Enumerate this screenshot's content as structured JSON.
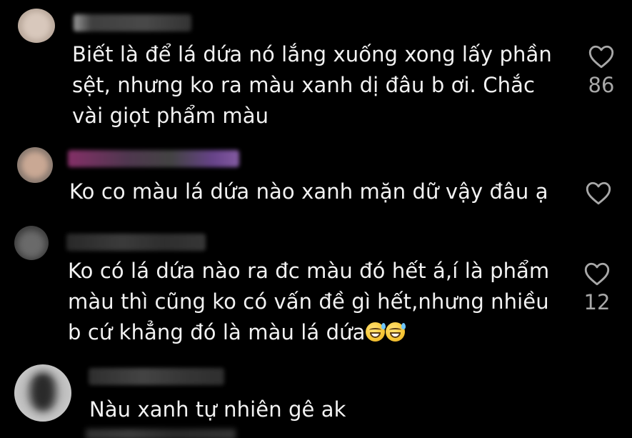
{
  "comments": [
    {
      "text_lines": [
        "Biết là để lá dứa nó lắng xuống xong lấy phần",
        "sệt, nhưng ko ra màu xanh dị đâu b ơi. Chắc",
        "vài giọt phẩm màu"
      ],
      "like_count": "86"
    },
    {
      "text_lines": [
        "Ko co màu lá dứa nào xanh mặn dữ vậy đâu ạ"
      ],
      "like_count": ""
    },
    {
      "text_lines": [
        "Ko có lá dứa nào ra đc màu đó hết á,í là phẩm",
        "màu thì cũng ko có vấn đề gì hết,nhưng nhiều",
        "b cứ khẳng đó là màu lá dứa"
      ],
      "emojis": [
        "grinning-sweat-emoji",
        "grinning-sweat-emoji"
      ],
      "like_count": "12"
    },
    {
      "text_lines": [
        "Nàu xanh tự nhiên gê ak"
      ],
      "like_count": ""
    }
  ],
  "icons": {
    "like": "heart-outline-icon"
  },
  "colors": {
    "background": "#000000",
    "text": "#f2f2f2",
    "muted": "#a8a8a8"
  }
}
